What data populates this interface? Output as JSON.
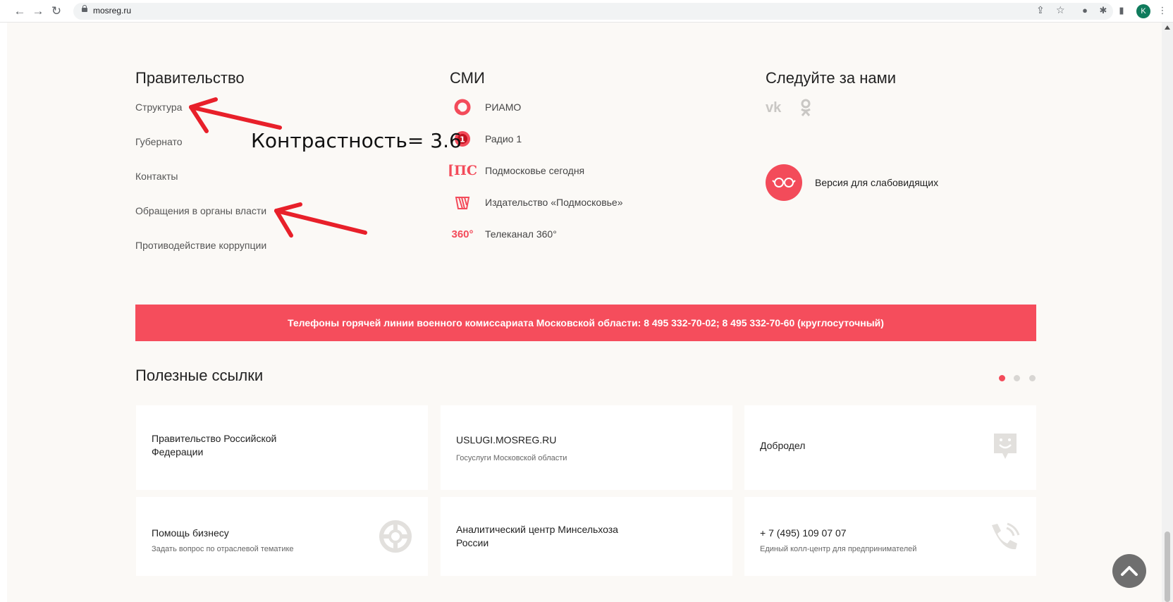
{
  "browser": {
    "url": "mosreg.ru",
    "profile_initial": "K"
  },
  "government": {
    "title": "Правительство",
    "links": [
      "Структура",
      "Губернато",
      "Контакты",
      "Обращения в органы власти",
      "Противодействие коррупции"
    ]
  },
  "media": {
    "title": "СМИ",
    "items": [
      {
        "icon": "riamo-icon",
        "label": "РИАМО"
      },
      {
        "icon": "radio1-icon",
        "label": "Радио 1"
      },
      {
        "icon": "ps-icon",
        "icon_text": "[ПС",
        "label": "Подмосковье сегодня"
      },
      {
        "icon": "publisher-icon",
        "label": "Издательство «Подмосковье»"
      },
      {
        "icon": "tv360-icon",
        "icon_text": "360°",
        "label": "Телеканал 360°"
      }
    ]
  },
  "follow": {
    "title": "Следуйте за нами",
    "vk_text": "vk",
    "accessibility_label": "Версия для слабовидящих"
  },
  "hotline": {
    "text": "Телефоны горячей линии военного комиссариата Московской области: 8 495 332-70-02; 8 495 332-70-60 (круглосуточный)"
  },
  "useful_links": {
    "title": "Полезные ссылки",
    "cards": [
      {
        "title_line1": "Правительство Российской",
        "title_line2": "Федерации"
      },
      {
        "title": "USLUGI.MOSREG.RU",
        "subtitle": "Госуслуги Московской области"
      },
      {
        "title": "Добродел",
        "icon": "dobrodel-icon"
      },
      {
        "title": "Помощь бизнесу",
        "subtitle": "Задать вопрос по отраслевой тематике",
        "icon": "lifebuoy-icon"
      },
      {
        "title_line1": "Аналитический центр Минсельхоза",
        "title_line2": "России"
      },
      {
        "title": "+ 7 (495) 109 07 07",
        "subtitle": "Единый колл-центр для предпринимателей",
        "icon": "phone-icon"
      }
    ]
  },
  "annotation": {
    "text": "Контрастность= 3.6",
    "color": "#e8202a"
  },
  "colors": {
    "accent": "#f34b5a",
    "page_bg": "#fbf9f6"
  }
}
